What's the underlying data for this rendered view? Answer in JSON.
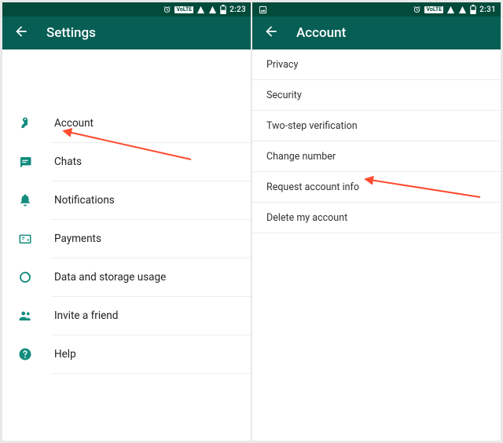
{
  "left": {
    "status": {
      "time": "2:23",
      "lte": "VoLTE"
    },
    "title": "Settings",
    "items": [
      {
        "id": "account",
        "label": "Account",
        "icon": "key"
      },
      {
        "id": "chats",
        "label": "Chats",
        "icon": "chat"
      },
      {
        "id": "notifications",
        "label": "Notifications",
        "icon": "bell"
      },
      {
        "id": "payments",
        "label": "Payments",
        "icon": "payment"
      },
      {
        "id": "storage",
        "label": "Data and storage usage",
        "icon": "data"
      },
      {
        "id": "invite",
        "label": "Invite a friend",
        "icon": "people"
      },
      {
        "id": "help",
        "label": "Help",
        "icon": "help"
      }
    ]
  },
  "right": {
    "status": {
      "time": "2:31",
      "lte": "VoLTE"
    },
    "title": "Account",
    "items": [
      {
        "id": "privacy",
        "label": "Privacy"
      },
      {
        "id": "security",
        "label": "Security"
      },
      {
        "id": "two-step",
        "label": "Two-step verification"
      },
      {
        "id": "change-number",
        "label": "Change number"
      },
      {
        "id": "request-info",
        "label": "Request account info"
      },
      {
        "id": "delete",
        "label": "Delete my account"
      }
    ]
  },
  "colors": {
    "teal": "#075E54",
    "iconTeal": "#128C7E",
    "accentArrow": "#ff4b2e"
  }
}
